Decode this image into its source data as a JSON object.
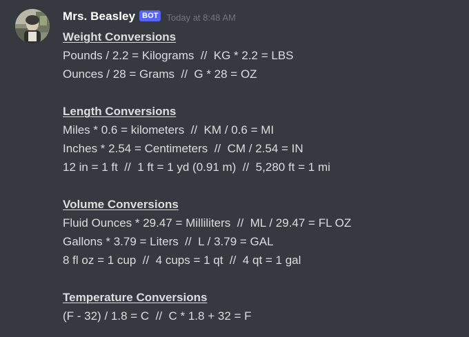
{
  "message": {
    "author": "Mrs. Beasley",
    "bot_tag": "BOT",
    "timestamp": "Today at 8:48 AM",
    "sections": [
      {
        "title": "Weight Conversions",
        "lines": [
          "Pounds / 2.2 = Kilograms  //  KG * 2.2 = LBS",
          "Ounces / 28 = Grams  //  G * 28 = OZ"
        ]
      },
      {
        "title": "Length Conversions",
        "lines": [
          "Miles * 0.6 = kilometers  //  KM / 0.6 = MI",
          "Inches * 2.54 = Centimeters  //  CM / 2.54 = IN",
          "12 in = 1 ft  //  1 ft = 1 yd (0.91 m)  //  5,280 ft = 1 mi"
        ]
      },
      {
        "title": "Volume Conversions",
        "lines": [
          "Fluid Ounces * 29.47 = Milliliters  //  ML / 29.47 = FL OZ",
          "Gallons * 3.79 = Liters  //  L / 3.79 = GAL",
          "8 fl oz = 1 cup  //  4 cups = 1 qt  //  4 qt = 1 gal"
        ]
      },
      {
        "title": "Temperature Conversions",
        "lines": [
          "(F - 32) / 1.8 = C  //  C * 1.8 + 32 = F"
        ]
      }
    ]
  },
  "colors": {
    "background": "#36393f",
    "username": "#ffffff",
    "bot_tag": "#5865f2",
    "timestamp": "#72767d",
    "text": "#dcddde"
  },
  "icons": {
    "avatar": "user-avatar-photo"
  }
}
